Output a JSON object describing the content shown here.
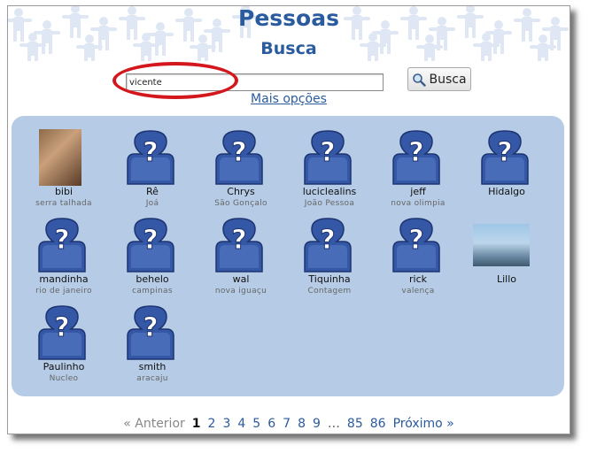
{
  "header": {
    "title": "Pessoas",
    "subtitle": "Busca"
  },
  "search": {
    "value": "vicente",
    "button_label": "Busca",
    "more_options": "Mais opções"
  },
  "people": [
    {
      "name": "bibi",
      "location": "serra talhada",
      "photo": "photo-woman"
    },
    {
      "name": "Rê",
      "location": "Joá",
      "photo": "default-avatar-icon"
    },
    {
      "name": "Chrys",
      "location": "São Gonçalo",
      "photo": "default-avatar-icon"
    },
    {
      "name": "luciclealins",
      "location": "João Pessoa",
      "photo": "default-avatar-icon"
    },
    {
      "name": "jeff",
      "location": "nova olimpia",
      "photo": "default-avatar-icon"
    },
    {
      "name": "Hidalgo",
      "location": "",
      "photo": "default-avatar-icon"
    },
    {
      "name": "mandinha",
      "location": "rio de janeiro",
      "photo": "default-avatar-icon"
    },
    {
      "name": "behelo",
      "location": "campinas",
      "photo": "default-avatar-icon"
    },
    {
      "name": "wal",
      "location": "nova iguaçu",
      "photo": "default-avatar-icon"
    },
    {
      "name": "Tiquinha",
      "location": "Contagem",
      "photo": "default-avatar-icon"
    },
    {
      "name": "rick",
      "location": "valença",
      "photo": "default-avatar-icon"
    },
    {
      "name": "Lillo",
      "location": "",
      "photo": "photo-man"
    },
    {
      "name": "Paulinho",
      "location": "Nucleo",
      "photo": "default-avatar-icon"
    },
    {
      "name": "smith",
      "location": "aracaju",
      "photo": "default-avatar-icon"
    }
  ],
  "pagination": {
    "prev": "« Anterior",
    "current": "1",
    "pages": [
      "2",
      "3",
      "4",
      "5",
      "6",
      "7",
      "8",
      "9"
    ],
    "ellipsis": "…",
    "last_pages": [
      "85",
      "86"
    ],
    "next": "Próximo »"
  },
  "colors": {
    "accent": "#2a5b9e",
    "panel": "#b5cbe6",
    "highlight": "#d3171c"
  }
}
